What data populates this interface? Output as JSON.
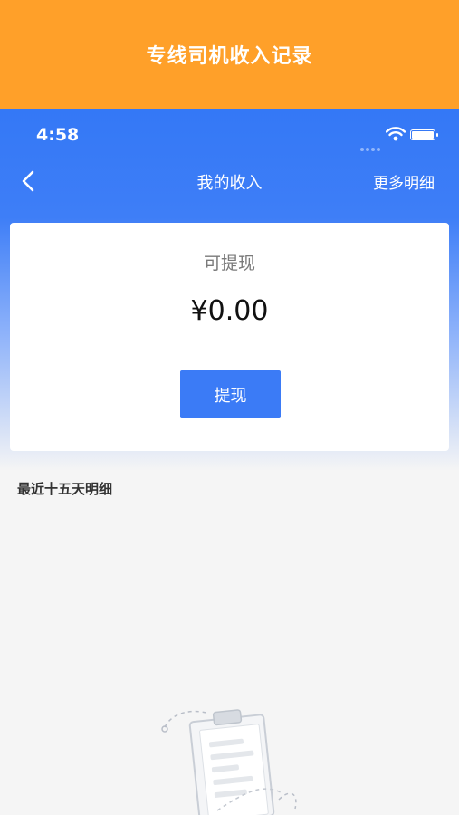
{
  "banner": {
    "title": "专线司机收入记录"
  },
  "status_bar": {
    "time": "4:58"
  },
  "nav": {
    "title": "我的收入",
    "more": "更多明细"
  },
  "balance": {
    "label": "可提现",
    "amount": "¥0.00",
    "button": "提现"
  },
  "recent": {
    "title": "最近十五天明细"
  },
  "colors": {
    "banner": "#FFA029",
    "primary": "#3478F6",
    "button": "#3B7BF6",
    "background": "#f5f5f5"
  },
  "icons": {
    "back": "chevron-left-icon",
    "wifi": "wifi-icon",
    "battery": "battery-icon",
    "empty": "clipboard-illustration"
  }
}
